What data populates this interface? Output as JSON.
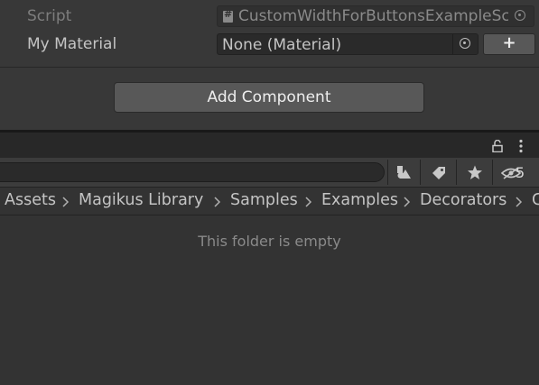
{
  "inspector": {
    "script_label": "Script",
    "script_value": "CustomWidthForButtonsExampleScript",
    "material_label": "My Material",
    "material_value": "None (Material)",
    "add_button_label": "+",
    "add_component_label": "Add Component"
  },
  "project": {
    "search_value": "",
    "hidden_count": "5",
    "breadcrumb": [
      "Assets",
      "Magikus Library",
      "Samples",
      "Examples",
      "Decorators",
      "C"
    ],
    "empty_message": "This folder is empty"
  },
  "colors": {
    "background": "#383838",
    "field_bg": "#2a2a2a",
    "button_bg": "#585858",
    "project_bg": "#333333"
  },
  "icons": {
    "script": "script-icon",
    "picker": "object-picker-icon",
    "lock": "lock-icon",
    "menu": "kebab-menu-icon",
    "search_by_type": "shapes-icon",
    "labels": "tag-icon",
    "favorites": "star-icon",
    "hidden_packages": "eye-slash-icon"
  }
}
